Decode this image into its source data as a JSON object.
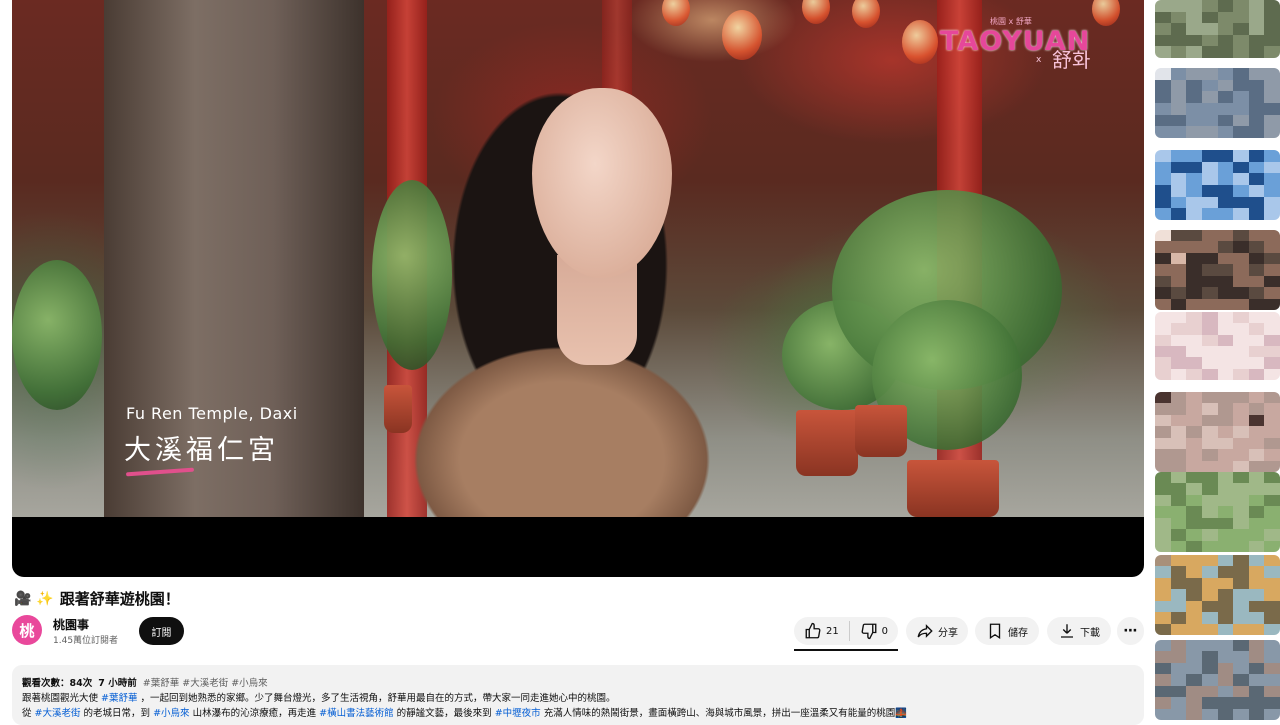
{
  "video": {
    "caption_en": "Fu Ren Temple, Daxi",
    "caption_zh": "大溪福仁宮",
    "logo_small": "桃園 x 舒華",
    "logo_main": "TAOYUAN",
    "logo_x": "x",
    "logo_signature": "舒화"
  },
  "title": {
    "emoji": "🎥 ✨",
    "text": "跟著舒華遊桃園！"
  },
  "channel": {
    "avatar_text": "桃",
    "name": "桃園事",
    "subscribers": "1.45萬位訂閱者",
    "subscribe_label": "訂閱"
  },
  "actions": {
    "like_count": "21",
    "dislike_count": "0",
    "share_label": "分享",
    "save_label": "儲存",
    "download_label": "下載",
    "more_label": "⋯"
  },
  "description": {
    "views_label": "觀看次數：",
    "views_count": "84次",
    "time_ago": "7 小時前",
    "header_tags": "#葉舒華 #大溪老街 #小烏來",
    "line2_a": "跟著桃園觀光大使",
    "line2_tag": "#葉舒華",
    "line2_b": "，一起回到她熟悉的家鄉。少了舞台燈光，多了生活視角，舒華用最自在的方式，帶大家一同走進她心中的桃園。",
    "line3_a": "從",
    "line3_tag1": "#大溪老街",
    "line3_b": "的老城日常，到",
    "line3_tag2": "#小烏來",
    "line3_c": "山林瀑布的沁涼療癒，再走進",
    "line3_tag3": "#橫山書法藝術館",
    "line3_d": "的靜謐文藝，最後來到",
    "line3_tag4": "#中壢夜市",
    "line3_e": "充滿人情味的熱鬧街景，畫面橫跨山、海與城市風景，拼出一座溫柔又有能量的桃園🌉"
  },
  "colors": {
    "accent_pink": "#e6479a",
    "link_blue": "#065fd4",
    "button_bg": "#f2f2f2"
  },
  "icons": {
    "like": "thumbs-up-icon",
    "dislike": "thumbs-down-icon",
    "share": "share-arrow-icon",
    "save": "bookmark-icon",
    "download": "download-icon",
    "more": "more-horizontal-icon"
  }
}
